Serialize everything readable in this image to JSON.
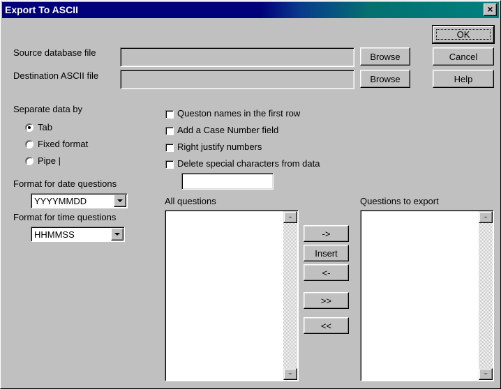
{
  "window": {
    "title": "Export To ASCII",
    "close_label": "×"
  },
  "files": {
    "source_label": "Source database file",
    "source_value": "",
    "destination_label": "Destination ASCII file",
    "destination_value": "",
    "browse_label": "Browse"
  },
  "actions": {
    "ok_label": "OK",
    "cancel_label": "Cancel",
    "help_label": "Help"
  },
  "separator": {
    "heading": "Separate data by",
    "options": [
      {
        "label": "Tab",
        "selected": true
      },
      {
        "label": "Fixed format",
        "selected": false
      },
      {
        "label": "Pipe |",
        "selected": false
      }
    ]
  },
  "date_format": {
    "label": "Format for date questions",
    "selected": "YYYYMMDD"
  },
  "time_format": {
    "label": "Format for time questions",
    "selected": "HHMMSS"
  },
  "options": {
    "checkboxes": [
      {
        "label": "Queston names in the first row",
        "checked": false
      },
      {
        "label": "Add a Case Number field",
        "checked": false
      },
      {
        "label": "Right justify numbers",
        "checked": false
      },
      {
        "label": "Delete special characters from data",
        "checked": false
      }
    ],
    "special_chars_value": ""
  },
  "lists": {
    "all_questions_label": "All questions",
    "export_label": "Questions to export",
    "all_questions": [],
    "questions_to_export": []
  },
  "transfer": {
    "add_label": "->",
    "insert_label": "Insert",
    "remove_label": "<-",
    "add_all_label": ">>",
    "remove_all_label": "<<"
  }
}
